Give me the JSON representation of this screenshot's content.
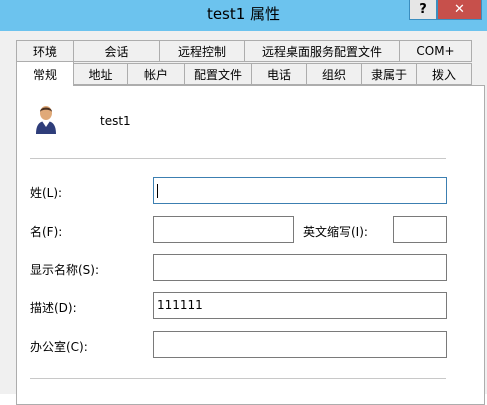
{
  "window": {
    "title": "test1 属性",
    "help_label": "?",
    "close_label": "✕"
  },
  "tabs_row1": [
    "环境",
    "会话",
    "远程控制",
    "远程桌面服务配置文件",
    "COM+"
  ],
  "tabs_row2": [
    "常规",
    "地址",
    "帐户",
    "配置文件",
    "电话",
    "组织",
    "隶属于",
    "拨入"
  ],
  "general": {
    "user_icon": "user-avatar-icon",
    "user_name": "test1",
    "last_name_label": "姓(L):",
    "last_name_value": "",
    "first_name_label": "名(F):",
    "first_name_value": "",
    "initials_label": "英文缩写(I):",
    "initials_value": "",
    "display_name_label": "显示名称(S):",
    "display_name_value": "",
    "description_label": "描述(D):",
    "description_value": "111111",
    "office_label": "办公室(C):",
    "office_value": ""
  }
}
